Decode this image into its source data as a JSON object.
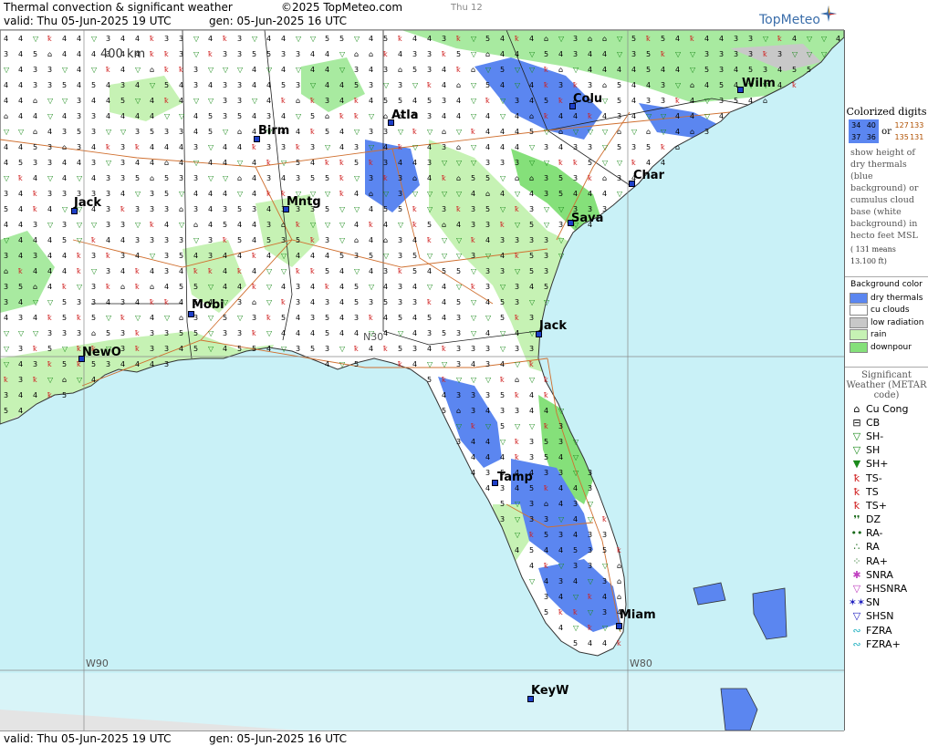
{
  "header": {
    "title": "Thermal convection & significant weather",
    "copyright": "©2025 TopMeteo.com",
    "day_tab": "Thu 12",
    "valid": "valid:  Thu  05-Jun-2025  19 UTC",
    "generated": "gen: 05-Jun-2025 16 UTC",
    "logo": "TopMeteo"
  },
  "footer": {
    "valid": "valid:  Thu  05-Jun-2025  19 UTC",
    "generated": "gen: 05-Jun-2025 16 UTC"
  },
  "map": {
    "scale_label": "400 km",
    "gridlines": [
      "W90",
      "W80",
      "N30"
    ],
    "cities": [
      "Wilm",
      "Colu",
      "Atla",
      "Birm",
      "Char",
      "Mntg",
      "Sava",
      "Jack",
      "Mobi",
      "NewO",
      "Jack",
      "Tamp",
      "Miam",
      "KeyW"
    ]
  },
  "legend": {
    "title": "Colorized digits",
    "sample_blue": [
      "34",
      "40",
      "37",
      "36"
    ],
    "sample_or": "or",
    "sample_white": [
      "127",
      "133",
      "135",
      "131"
    ],
    "description": "show height of dry thermals (blue background) or cumulus cloud base (white background) in hecto feet MSL",
    "example": "( 131 means 13.100 ft)",
    "background_title": "Background color",
    "background": [
      {
        "label": "dry thermals",
        "color": "#5b86f0"
      },
      {
        "label": "cu clouds",
        "color": "#ffffff"
      },
      {
        "label": "low radiation",
        "color": "#c8c8c8"
      },
      {
        "label": "rain",
        "color": "#c6f2b4"
      },
      {
        "label": "downpour",
        "color": "#85e07a"
      }
    ],
    "sigwx_title": "Significant Weather (METAR code)",
    "sigwx": [
      {
        "label": "Cu Cong",
        "icon": "cumulus-congestus-icon",
        "color": "#000000"
      },
      {
        "label": "CB",
        "icon": "cumulonimbus-icon",
        "color": "#000000"
      },
      {
        "label": "SH-",
        "icon": "shower-light-icon",
        "color": "#1a8a1a"
      },
      {
        "label": "SH",
        "icon": "shower-icon",
        "color": "#1a8a1a"
      },
      {
        "label": "SH+",
        "icon": "shower-heavy-icon",
        "color": "#1a8a1a"
      },
      {
        "label": "TS-",
        "icon": "thunderstorm-light-icon",
        "color": "#d02020"
      },
      {
        "label": "TS",
        "icon": "thunderstorm-icon",
        "color": "#d02020"
      },
      {
        "label": "TS+",
        "icon": "thunderstorm-heavy-icon",
        "color": "#d02020"
      },
      {
        "label": "DZ",
        "icon": "drizzle-icon",
        "color": "#1a6a1a"
      },
      {
        "label": "RA-",
        "icon": "rain-light-icon",
        "color": "#1a6a1a"
      },
      {
        "label": "RA",
        "icon": "rain-icon",
        "color": "#1a6a1a"
      },
      {
        "label": "RA+",
        "icon": "rain-heavy-icon",
        "color": "#1a6a1a"
      },
      {
        "label": "SNRA",
        "icon": "snow-rain-icon",
        "color": "#c040c0"
      },
      {
        "label": "SHSNRA",
        "icon": "snow-rain-shower-icon",
        "color": "#c040c0"
      },
      {
        "label": "SN",
        "icon": "snow-icon",
        "color": "#2020c0"
      },
      {
        "label": "SHSN",
        "icon": "snow-shower-icon",
        "color": "#2020c0"
      },
      {
        "label": "FZRA",
        "icon": "freezing-rain-icon",
        "color": "#20b0c0"
      },
      {
        "label": "FZRA+",
        "icon": "freezing-rain-heavy-icon",
        "color": "#20b0c0"
      }
    ]
  }
}
